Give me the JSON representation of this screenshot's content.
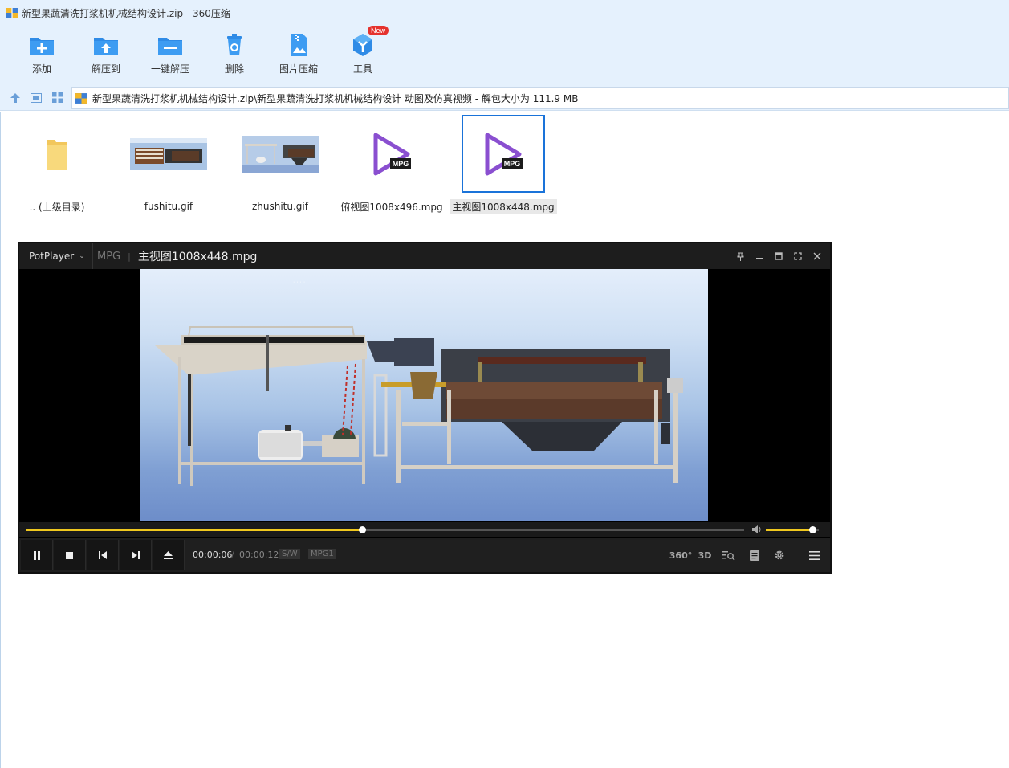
{
  "window": {
    "title": "新型果蔬清洗打浆机机械结构设计.zip - 360压缩"
  },
  "toolbar": {
    "items": [
      {
        "label": "添加",
        "icon": "add-folder-icon"
      },
      {
        "label": "解压到",
        "icon": "extract-to-icon"
      },
      {
        "label": "一键解压",
        "icon": "one-click-extract-icon"
      },
      {
        "label": "删除",
        "icon": "delete-icon"
      },
      {
        "label": "图片压缩",
        "icon": "image-compress-icon"
      },
      {
        "label": "工具",
        "icon": "tools-icon",
        "badge": "New"
      }
    ]
  },
  "address": {
    "path": "新型果蔬清洗打浆机机械结构设计.zip\\新型果蔬清洗打浆机机械结构设计 动图及仿真视频 - 解包大小为 111.9 MB"
  },
  "files": [
    {
      "name": ".. (上级目录)",
      "type": "parent-folder"
    },
    {
      "name": "fushitu.gif",
      "type": "gif"
    },
    {
      "name": "zhushitu.gif",
      "type": "gif"
    },
    {
      "name": "俯视图1008x496.mpg",
      "type": "mpg",
      "badge": "MPG"
    },
    {
      "name": "主视图1008x448.mpg",
      "type": "mpg",
      "badge": "MPG",
      "selected": true
    }
  ],
  "player": {
    "brand": "PotPlayer",
    "format": "MPG",
    "file_name": "主视图1008x448.mpg",
    "time_current": "00:00:06",
    "time_separator": "/",
    "time_total": "00:00:12",
    "tag_sw": "S/W",
    "tag_codec": "MPG1",
    "progress": 0.4679,
    "volume": 0.88,
    "right_buttons": [
      "360°",
      "3D"
    ],
    "accent": "#f0c81e"
  }
}
